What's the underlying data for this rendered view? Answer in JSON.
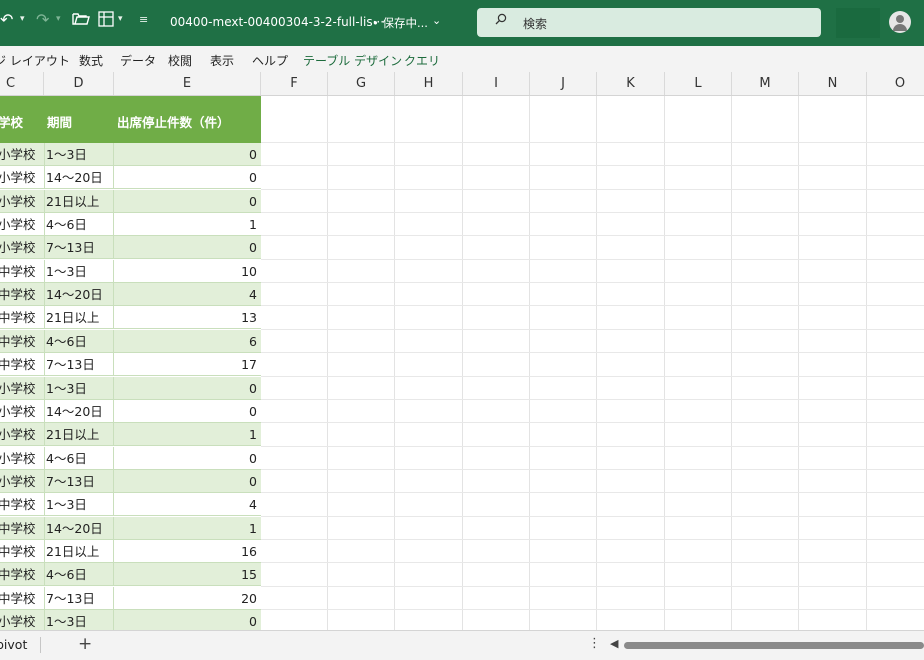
{
  "titlebar": {
    "undo_icon": "undo-icon",
    "redo_icon": "redo-icon",
    "folder_icon": "folder-icon",
    "form_icon": "form-icon",
    "customize_icon": "customize-qat-icon",
    "document_title": "00400-mext-00400304-3-2-full-lis···",
    "save_status": "• 保存中...",
    "search_placeholder": "検索",
    "colors": {
      "bar": "#1f7045",
      "search": "#d9ebe0"
    }
  },
  "ribbon": {
    "tabs": [
      "ジ レイアウト",
      "数式",
      "データ",
      "校閲",
      "表示",
      "ヘルプ",
      "テーブル デザイン",
      "クエリ"
    ]
  },
  "columns": [
    "C",
    "D",
    "E",
    "F",
    "G",
    "H",
    "I",
    "J",
    "K",
    "L",
    "M",
    "N",
    "O"
  ],
  "table": {
    "headers": {
      "c": "学校",
      "d": "期間",
      "e": "出席停止件数（件）"
    },
    "rows": [
      {
        "c": "小学校",
        "d": "1～3日",
        "e": "0"
      },
      {
        "c": "小学校",
        "d": "14～20日",
        "e": "0"
      },
      {
        "c": "小学校",
        "d": "21日以上",
        "e": "0"
      },
      {
        "c": "小学校",
        "d": "4～6日",
        "e": "1"
      },
      {
        "c": "小学校",
        "d": "7～13日",
        "e": "0"
      },
      {
        "c": "中学校",
        "d": "1～3日",
        "e": "10"
      },
      {
        "c": "中学校",
        "d": "14～20日",
        "e": "4"
      },
      {
        "c": "中学校",
        "d": "21日以上",
        "e": "13"
      },
      {
        "c": "中学校",
        "d": "4～6日",
        "e": "6"
      },
      {
        "c": "中学校",
        "d": "7～13日",
        "e": "17"
      },
      {
        "c": "小学校",
        "d": "1～3日",
        "e": "0"
      },
      {
        "c": "小学校",
        "d": "14～20日",
        "e": "0"
      },
      {
        "c": "小学校",
        "d": "21日以上",
        "e": "1"
      },
      {
        "c": "小学校",
        "d": "4～6日",
        "e": "0"
      },
      {
        "c": "小学校",
        "d": "7～13日",
        "e": "0"
      },
      {
        "c": "中学校",
        "d": "1～3日",
        "e": "4"
      },
      {
        "c": "中学校",
        "d": "14～20日",
        "e": "1"
      },
      {
        "c": "中学校",
        "d": "21日以上",
        "e": "16"
      },
      {
        "c": "中学校",
        "d": "4～6日",
        "e": "15"
      },
      {
        "c": "中学校",
        "d": "7～13日",
        "e": "20"
      },
      {
        "c": "小学校",
        "d": "1～3日",
        "e": "0"
      }
    ],
    "colors": {
      "header": "#70ad47",
      "band": "#e2efd9"
    }
  },
  "sheetbar": {
    "sheet_tab": "pivot",
    "add_label": "+",
    "more_label": "⋮",
    "scroll_left": "◀"
  }
}
